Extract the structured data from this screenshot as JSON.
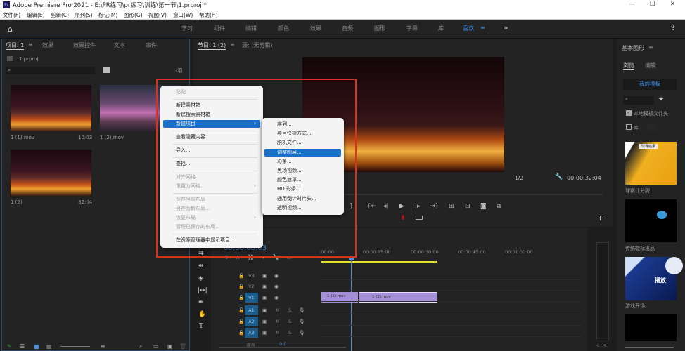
{
  "window": {
    "title": "Adobe Premiere Pro 2021 - E:\\PR练习\\pr练习\\训练\\第一节\\1.prproj *",
    "app_icon": "Pr",
    "minimize": "—",
    "restore": "❐",
    "close": "✕"
  },
  "menubar": [
    "文件(F)",
    "编辑(E)",
    "剪辑(C)",
    "序列(S)",
    "标记(M)",
    "图形(G)",
    "视图(V)",
    "窗口(W)",
    "帮助(H)"
  ],
  "workspaces": {
    "items": [
      "学习",
      "组件",
      "编辑",
      "颜色",
      "效果",
      "音频",
      "图形",
      "字幕",
      "库",
      "喜欢"
    ],
    "active": "喜欢",
    "more": "»"
  },
  "project": {
    "tabs": [
      "项目: 1",
      "效果",
      "效果控件",
      "文本",
      "事件"
    ],
    "menu": "≡",
    "file": "1.prproj",
    "count": "3项",
    "clips": [
      {
        "name": "1 (1).mov",
        "duration": "10:03"
      },
      {
        "name": "1 (2).mov",
        "duration": ""
      },
      {
        "name": "1 (2)",
        "duration": "32:04"
      }
    ]
  },
  "program": {
    "tab": "节目: 1 (2)",
    "menu": "≡",
    "source_tab": "源: (无剪辑)",
    "resolution": "1/2",
    "timecode": "00:00:32:04",
    "add": "+"
  },
  "timeline": {
    "timecode": "00:00:08:03",
    "ruler": [
      ":00:00",
      "00:00:15:00",
      "00:00:30:00",
      "00:00:45:00",
      "00:01:00:00"
    ],
    "video_tracks": [
      "V3",
      "V2",
      "V1"
    ],
    "audio_tracks": [
      "A1",
      "A2",
      "A3"
    ],
    "mix_label": "混合",
    "mix_value": "0.0",
    "mute": "M",
    "solo": "S",
    "clips": [
      "1 (1).mov",
      "1 (2).mov"
    ],
    "clip_color": "#a58fd6",
    "meter_labels": [
      "S",
      "S"
    ]
  },
  "essential_graphics": {
    "title": "基本图形",
    "menu": "≡",
    "tabs": [
      "浏览",
      "编辑"
    ],
    "my_templates": "我的模板",
    "local_folder": "本地模板文件夹",
    "local_checked": true,
    "library": "库",
    "library_checked": false,
    "templates": [
      {
        "name": "球赛计分牌",
        "caption": "球赛结果"
      },
      {
        "name": "传统徽标出品",
        "caption": ""
      },
      {
        "name": "游戏开场",
        "caption": "播放"
      }
    ]
  },
  "context_menu": {
    "items": [
      {
        "label": "粘贴",
        "disabled": true
      },
      {
        "sep": true
      },
      {
        "label": "新建素材箱"
      },
      {
        "label": "新建搜索素材箱"
      },
      {
        "label": "新建项目",
        "highlighted": true,
        "submenu": true
      },
      {
        "sep": true
      },
      {
        "label": "查看隐藏内容"
      },
      {
        "sep": true
      },
      {
        "label": "导入..."
      },
      {
        "sep": true
      },
      {
        "label": "查找..."
      },
      {
        "sep": true
      },
      {
        "label": "对齐网格",
        "disabled": true
      },
      {
        "label": "重置为网格",
        "disabled": true,
        "submenu": true
      },
      {
        "sep": true
      },
      {
        "label": "保存当前布局",
        "disabled": true
      },
      {
        "label": "另存为新布局...",
        "disabled": true
      },
      {
        "label": "恢复布局",
        "disabled": true,
        "submenu": true
      },
      {
        "label": "管理已保存的布局...",
        "disabled": true
      },
      {
        "sep": true
      },
      {
        "label": "在资源管理器中显示项目..."
      }
    ],
    "submenu": [
      "序列...",
      "项目快捷方式...",
      "脱机文件...",
      "调整图层...",
      "彩条...",
      "黑场视频...",
      "颜色遮罩...",
      "HD 彩条...",
      "通用倒计时片头...",
      "透明视频..."
    ],
    "submenu_highlighted": "调整图层...",
    "arrow": "›"
  },
  "colors": {
    "accent": "#1a6fc9",
    "highlight_box": "#d9321f",
    "timecode_blue": "#3a8ee6",
    "playhead": "#4a90e2",
    "in_out_bar": "#e8e030"
  }
}
